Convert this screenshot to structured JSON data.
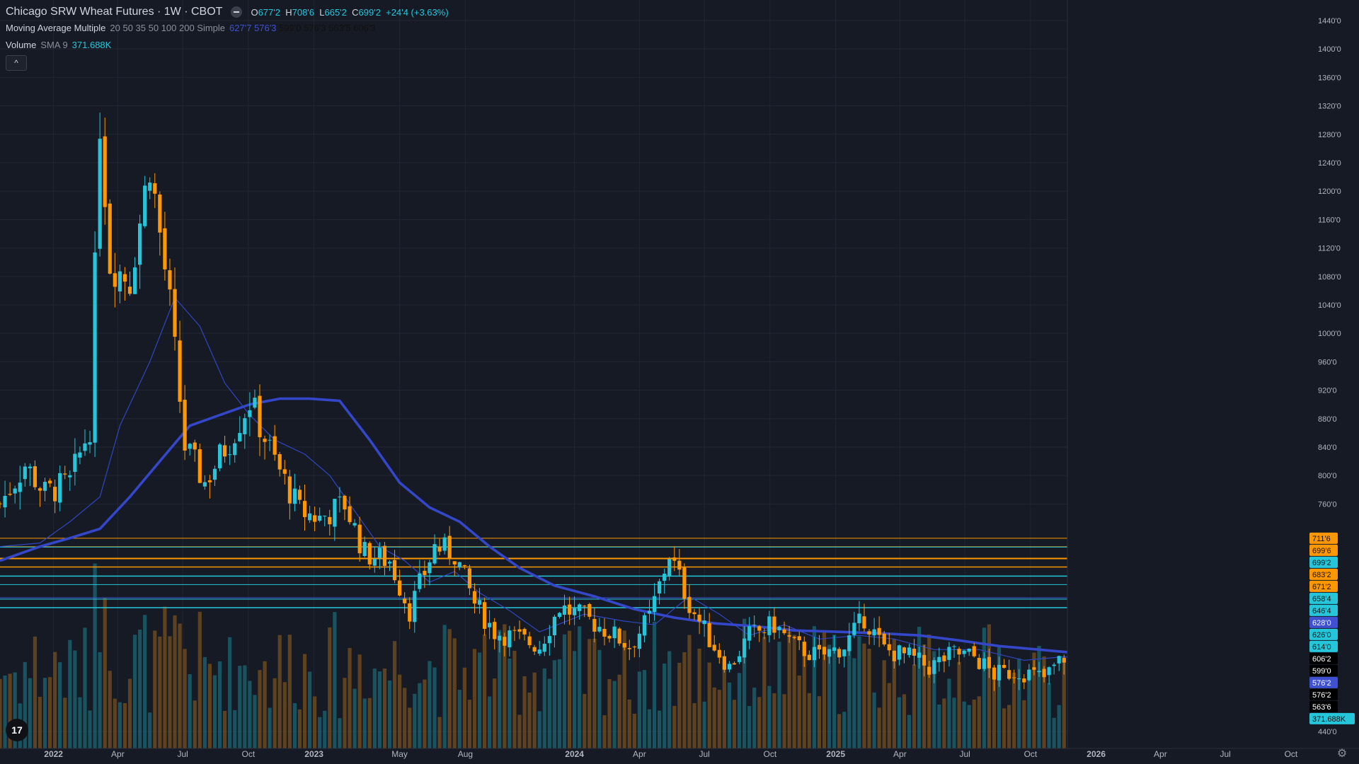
{
  "header": {
    "title": "Chicago SRW Wheat Futures · 1W · CBOT",
    "ohlc": [
      {
        "k": "O",
        "v": "677'2"
      },
      {
        "k": "H",
        "v": "708'6"
      },
      {
        "k": "L",
        "v": "665'2"
      },
      {
        "k": "C",
        "v": "699'2"
      }
    ],
    "change": "+24'4 (+3.63%)"
  },
  "ma_legend": {
    "name": "Moving Average Multiple",
    "params": "20 50 35 50 100 200 Simple",
    "values": [
      {
        "text": "627'7",
        "color": "#3f51d1"
      },
      {
        "text": "576'3",
        "color": "#3f51d1"
      },
      {
        "text": "599'0",
        "color": "#111111"
      },
      {
        "text": "576'3",
        "color": "#111111"
      },
      {
        "text": "563'5",
        "color": "#111111"
      },
      {
        "text": "606'3",
        "color": "#111111"
      }
    ]
  },
  "volume_legend": {
    "name": "Volume",
    "params": "SMA 9",
    "value": "371.688K"
  },
  "collapse_label": "^",
  "logo_text": "17",
  "chart_data": {
    "type": "candlestick",
    "title": "Chicago SRW Wheat Futures · 1W · CBOT",
    "ylim": [
      420,
      1445
    ],
    "y_ticks": [
      "1440'0",
      "1400'0",
      "1360'0",
      "1320'0",
      "1280'0",
      "1240'0",
      "1200'0",
      "1160'0",
      "1120'0",
      "1080'0",
      "1040'0",
      "1000'0",
      "960'0",
      "920'0",
      "880'0",
      "840'0",
      "800'0",
      "760'0",
      "440'0"
    ],
    "y_tick_values": [
      1440,
      1400,
      1360,
      1320,
      1280,
      1240,
      1200,
      1160,
      1120,
      1080,
      1040,
      1000,
      960,
      920,
      880,
      840,
      800,
      760,
      440
    ],
    "x_ticks": [
      {
        "label": "2022",
        "date": "2022-01-01",
        "bold": true
      },
      {
        "label": "Apr",
        "date": "2022-04-01"
      },
      {
        "label": "Jul",
        "date": "2022-07-01"
      },
      {
        "label": "Oct",
        "date": "2022-10-01"
      },
      {
        "label": "2023",
        "date": "2023-01-01",
        "bold": true
      },
      {
        "label": "May",
        "date": "2023-05-01"
      },
      {
        "label": "Aug",
        "date": "2023-08-01"
      },
      {
        "label": "2024",
        "date": "2024-01-01",
        "bold": true
      },
      {
        "label": "Apr",
        "date": "2024-04-01"
      },
      {
        "label": "Jul",
        "date": "2024-07-01"
      },
      {
        "label": "Oct",
        "date": "2024-10-01"
      },
      {
        "label": "2025",
        "date": "2025-01-01",
        "bold": true
      },
      {
        "label": "Apr",
        "date": "2025-04-01"
      },
      {
        "label": "Jul",
        "date": "2025-07-01"
      },
      {
        "label": "Oct",
        "date": "2025-10-01"
      },
      {
        "label": "2026",
        "date": "2026-01-01",
        "bold": true
      },
      {
        "label": "Apr",
        "date": "2026-04-01"
      },
      {
        "label": "Jul",
        "date": "2026-07-01"
      },
      {
        "label": "Oct",
        "date": "2026-10-01"
      }
    ],
    "x_start": "2021-10-18",
    "x_end": "2026-10-12",
    "bar_end": "2026-08-24",
    "closes": [
      {
        "date": "2021-10-18",
        "value": 760
      },
      {
        "date": "2021-11-22",
        "value": 815
      },
      {
        "date": "2021-12-20",
        "value": 775
      },
      {
        "date": "2022-01-24",
        "value": 790
      },
      {
        "date": "2022-02-21",
        "value": 870
      },
      {
        "date": "2022-03-07",
        "value": 1300
      },
      {
        "date": "2022-03-21",
        "value": 1100
      },
      {
        "date": "2022-04-18",
        "value": 1075
      },
      {
        "date": "2022-05-16",
        "value": 1240
      },
      {
        "date": "2022-06-13",
        "value": 1040
      },
      {
        "date": "2022-07-04",
        "value": 840
      },
      {
        "date": "2022-08-01",
        "value": 790
      },
      {
        "date": "2022-09-05",
        "value": 850
      },
      {
        "date": "2022-10-03",
        "value": 905
      },
      {
        "date": "2022-11-07",
        "value": 820
      },
      {
        "date": "2022-12-12",
        "value": 750
      },
      {
        "date": "2023-01-09",
        "value": 740
      },
      {
        "date": "2023-02-13",
        "value": 760
      },
      {
        "date": "2023-03-13",
        "value": 690
      },
      {
        "date": "2023-04-17",
        "value": 680
      },
      {
        "date": "2023-05-15",
        "value": 610
      },
      {
        "date": "2023-06-19",
        "value": 700
      },
      {
        "date": "2023-07-17",
        "value": 690
      },
      {
        "date": "2023-08-14",
        "value": 620
      },
      {
        "date": "2023-09-11",
        "value": 580
      },
      {
        "date": "2023-10-16",
        "value": 570
      },
      {
        "date": "2023-11-13",
        "value": 560
      },
      {
        "date": "2023-12-11",
        "value": 615
      },
      {
        "date": "2024-01-15",
        "value": 600
      },
      {
        "date": "2024-02-19",
        "value": 580
      },
      {
        "date": "2024-03-18",
        "value": 560
      },
      {
        "date": "2024-04-15",
        "value": 600
      },
      {
        "date": "2024-05-13",
        "value": 690
      },
      {
        "date": "2024-06-10",
        "value": 620
      },
      {
        "date": "2024-07-08",
        "value": 570
      },
      {
        "date": "2024-08-05",
        "value": 530
      },
      {
        "date": "2024-09-02",
        "value": 575
      },
      {
        "date": "2024-10-07",
        "value": 590
      },
      {
        "date": "2024-11-04",
        "value": 560
      },
      {
        "date": "2024-12-09",
        "value": 545
      },
      {
        "date": "2025-01-13",
        "value": 560
      },
      {
        "date": "2025-02-10",
        "value": 600
      },
      {
        "date": "2025-03-10",
        "value": 555
      },
      {
        "date": "2025-04-14",
        "value": 545
      },
      {
        "date": "2025-05-12",
        "value": 530
      },
      {
        "date": "2025-06-16",
        "value": 550
      },
      {
        "date": "2025-07-14",
        "value": 545
      },
      {
        "date": "2025-08-11",
        "value": 520
      },
      {
        "date": "2025-09-15",
        "value": 525
      },
      {
        "date": "2025-10-20",
        "value": 515
      },
      {
        "date": "2025-11-17",
        "value": 545
      },
      {
        "date": "2025-12-15",
        "value": 535
      },
      {
        "date": "2026-01-19",
        "value": 540
      },
      {
        "date": "2026-02-16",
        "value": 565
      },
      {
        "date": "2026-03-16",
        "value": 600
      },
      {
        "date": "2026-04-13",
        "value": 615
      },
      {
        "date": "2026-05-11",
        "value": 630
      },
      {
        "date": "2026-06-08",
        "value": 610
      },
      {
        "date": "2026-07-06",
        "value": 660
      },
      {
        "date": "2026-08-03",
        "value": 670
      },
      {
        "date": "2026-08-24",
        "value": 699
      }
    ],
    "series": [
      {
        "color": "#2f46c0",
        "width": 1.2,
        "points": [
          {
            "date": "2021-10-18",
            "value": 700
          },
          {
            "date": "2021-12-13",
            "value": 705
          },
          {
            "date": "2022-01-24",
            "value": 735
          },
          {
            "date": "2022-03-07",
            "value": 770
          },
          {
            "date": "2022-04-04",
            "value": 870
          },
          {
            "date": "2022-05-16",
            "value": 960
          },
          {
            "date": "2022-06-20",
            "value": 1050
          },
          {
            "date": "2022-07-25",
            "value": 1010
          },
          {
            "date": "2022-08-29",
            "value": 930
          },
          {
            "date": "2022-10-03",
            "value": 885
          },
          {
            "date": "2022-11-07",
            "value": 850
          },
          {
            "date": "2022-12-19",
            "value": 830
          },
          {
            "date": "2023-01-23",
            "value": 800
          },
          {
            "date": "2023-02-27",
            "value": 750
          },
          {
            "date": "2023-04-03",
            "value": 700
          },
          {
            "date": "2023-05-08",
            "value": 680
          },
          {
            "date": "2023-06-12",
            "value": 650
          },
          {
            "date": "2023-07-17",
            "value": 665
          },
          {
            "date": "2023-08-21",
            "value": 635
          },
          {
            "date": "2023-10-02",
            "value": 610
          },
          {
            "date": "2023-11-13",
            "value": 580
          },
          {
            "date": "2024-01-15",
            "value": 605
          },
          {
            "date": "2024-03-11",
            "value": 595
          },
          {
            "date": "2024-04-22",
            "value": 590
          },
          {
            "date": "2024-06-10",
            "value": 630
          },
          {
            "date": "2024-07-22",
            "value": 605
          },
          {
            "date": "2024-09-02",
            "value": 575
          },
          {
            "date": "2024-10-21",
            "value": 590
          },
          {
            "date": "2024-12-09",
            "value": 570
          },
          {
            "date": "2025-02-03",
            "value": 575
          },
          {
            "date": "2025-03-24",
            "value": 570
          },
          {
            "date": "2025-05-19",
            "value": 555
          },
          {
            "date": "2025-07-21",
            "value": 555
          },
          {
            "date": "2025-09-22",
            "value": 540
          },
          {
            "date": "2025-11-17",
            "value": 545
          },
          {
            "date": "2026-01-19",
            "value": 540
          },
          {
            "date": "2026-03-09",
            "value": 560
          },
          {
            "date": "2026-04-20",
            "value": 595
          },
          {
            "date": "2026-06-01",
            "value": 610
          },
          {
            "date": "2026-07-13",
            "value": 625
          },
          {
            "date": "2026-08-24",
            "value": 648
          }
        ]
      },
      {
        "color": "#3347c8",
        "width": 3.6,
        "points": [
          {
            "date": "2021-10-18",
            "value": 680
          },
          {
            "date": "2021-12-13",
            "value": 700
          },
          {
            "date": "2022-01-24",
            "value": 712
          },
          {
            "date": "2022-03-07",
            "value": 725
          },
          {
            "date": "2022-04-18",
            "value": 770
          },
          {
            "date": "2022-05-30",
            "value": 820
          },
          {
            "date": "2022-07-11",
            "value": 870
          },
          {
            "date": "2022-08-22",
            "value": 885
          },
          {
            "date": "2022-10-03",
            "value": 900
          },
          {
            "date": "2022-11-14",
            "value": 908
          },
          {
            "date": "2022-12-26",
            "value": 908
          },
          {
            "date": "2023-02-06",
            "value": 905
          },
          {
            "date": "2023-03-20",
            "value": 850
          },
          {
            "date": "2023-05-01",
            "value": 790
          },
          {
            "date": "2023-06-12",
            "value": 755
          },
          {
            "date": "2023-07-24",
            "value": 735
          },
          {
            "date": "2023-09-04",
            "value": 700
          },
          {
            "date": "2023-10-16",
            "value": 670
          },
          {
            "date": "2023-12-04",
            "value": 645
          },
          {
            "date": "2024-01-29",
            "value": 630
          },
          {
            "date": "2024-03-25",
            "value": 612
          },
          {
            "date": "2024-05-20",
            "value": 600
          },
          {
            "date": "2024-07-15",
            "value": 592
          },
          {
            "date": "2024-09-09",
            "value": 588
          },
          {
            "date": "2024-11-04",
            "value": 582
          },
          {
            "date": "2025-01-06",
            "value": 580
          },
          {
            "date": "2025-03-03",
            "value": 578
          },
          {
            "date": "2025-04-28",
            "value": 575
          },
          {
            "date": "2025-06-23",
            "value": 568
          },
          {
            "date": "2025-08-18",
            "value": 560
          },
          {
            "date": "2025-10-13",
            "value": 555
          },
          {
            "date": "2025-12-08",
            "value": 550
          },
          {
            "date": "2026-02-02",
            "value": 548
          },
          {
            "date": "2026-03-30",
            "value": 552
          },
          {
            "date": "2026-05-25",
            "value": 560
          },
          {
            "date": "2026-07-20",
            "value": 570
          },
          {
            "date": "2026-08-24",
            "value": 588
          }
        ]
      }
    ],
    "hlines": [
      {
        "value": 711.75,
        "color": "#ff9800",
        "width": 1
      },
      {
        "value": 699.75,
        "color": "#ff9800",
        "width": 1
      },
      {
        "value": 699.25,
        "color": "#26c6da",
        "width": 1
      },
      {
        "value": 683.25,
        "color": "#ff9800",
        "width": 2
      },
      {
        "value": 671.25,
        "color": "#ff9800",
        "width": 1.5
      },
      {
        "value": 658.5,
        "color": "#26c6da",
        "width": 1.5
      },
      {
        "value": 646.5,
        "color": "#26c6da",
        "width": 1
      },
      {
        "value": 628.0,
        "color": "#3f51d1",
        "width": 1
      },
      {
        "value": 626.0,
        "color": "#26c6da",
        "width": 1
      },
      {
        "value": 614.0,
        "color": "#26c6da",
        "width": 1.5
      }
    ],
    "price_labels": [
      {
        "text": "711'6",
        "value": 711.75,
        "bg": "#ff9800",
        "fg": "#111"
      },
      {
        "text": "699'6",
        "value": 699.75,
        "bg": "#ff9800",
        "fg": "#111"
      },
      {
        "text": "699'2",
        "value": 699.25,
        "bg": "#26c6da",
        "fg": "#111"
      },
      {
        "text": "683'2",
        "value": 683.25,
        "bg": "#ff9800",
        "fg": "#111"
      },
      {
        "text": "671'2",
        "value": 671.25,
        "bg": "#ff9800",
        "fg": "#111"
      },
      {
        "text": "658'4",
        "value": 658.5,
        "bg": "#26c6da",
        "fg": "#111"
      },
      {
        "text": "646'4",
        "value": 646.5,
        "bg": "#26c6da",
        "fg": "#111"
      },
      {
        "text": "628'0",
        "value": 628.0,
        "bg": "#3f51d1",
        "fg": "#fff"
      },
      {
        "text": "626'0",
        "value": 626.0,
        "bg": "#26c6da",
        "fg": "#111"
      },
      {
        "text": "614'0",
        "value": 614.0,
        "bg": "#26c6da",
        "fg": "#111"
      },
      {
        "text": "606'2",
        "value": 606.25,
        "bg": "#000000",
        "fg": "#fff"
      },
      {
        "text": "599'0",
        "value": 599.0,
        "bg": "#000000",
        "fg": "#fff"
      },
      {
        "text": "576'2",
        "value": 576.25,
        "bg": "#3f51d1",
        "fg": "#fff"
      },
      {
        "text": "576'2",
        "value": 576.25,
        "bg": "#000000",
        "fg": "#fff"
      },
      {
        "text": "563'6",
        "value": 563.75,
        "bg": "#000000",
        "fg": "#fff"
      },
      {
        "text": "371.688K",
        "value": 535,
        "bg": "#26c6da",
        "fg": "#111"
      }
    ],
    "up_color": "#26c6da",
    "down_color": "#ff9800",
    "vol_up_color": "#1b5e6b",
    "vol_down_color": "#6b4a1e"
  }
}
